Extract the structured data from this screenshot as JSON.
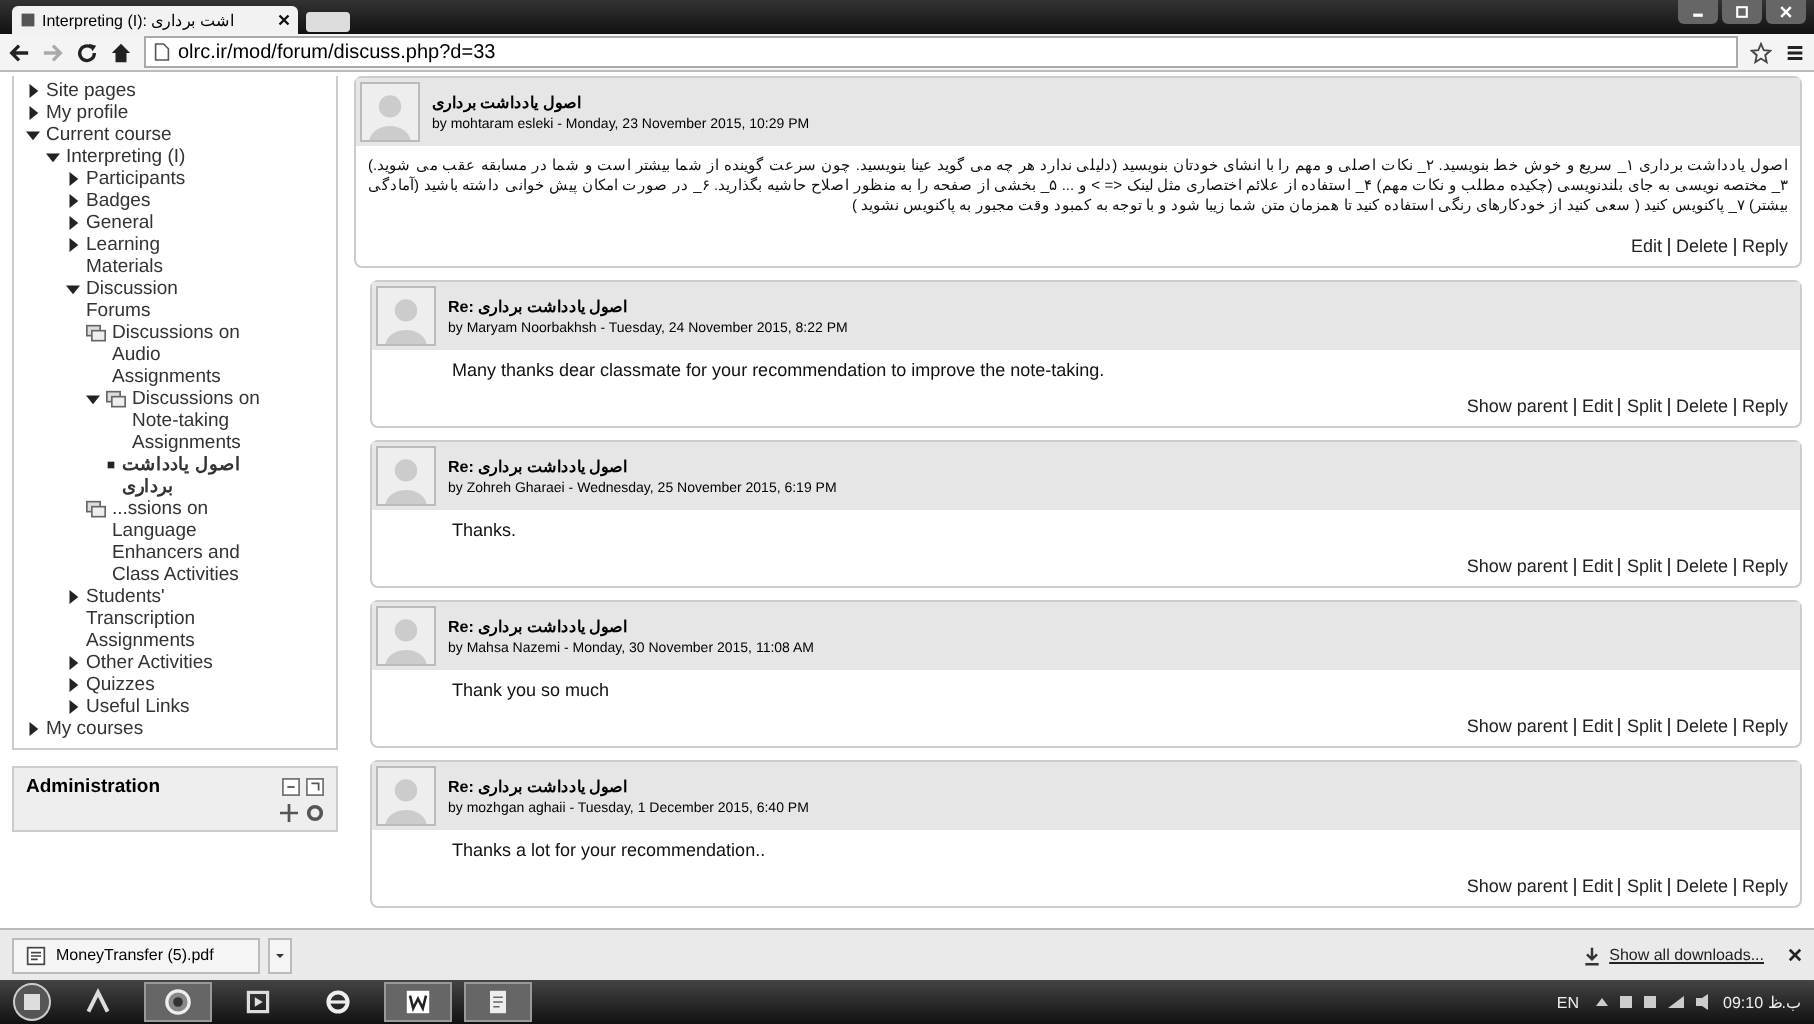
{
  "browser": {
    "tab_title": "Interpreting (I): اشت برداری",
    "url": "olrc.ir/mod/forum/discuss.php?d=33"
  },
  "sidebar": {
    "items": [
      {
        "kind": "branch",
        "label": "Site pages",
        "expanded": false
      },
      {
        "kind": "branch",
        "label": "My profile",
        "expanded": false
      },
      {
        "kind": "branch",
        "label": "Current course",
        "expanded": true,
        "children": [
          {
            "kind": "branch",
            "label": "Interpreting (I)",
            "expanded": true,
            "children": [
              {
                "kind": "branch",
                "label": "Participants",
                "expanded": false
              },
              {
                "kind": "branch",
                "label": "Badges",
                "expanded": false
              },
              {
                "kind": "branch",
                "label": "General",
                "expanded": false
              },
              {
                "kind": "branch",
                "label": "Learning Materials",
                "expanded": false
              },
              {
                "kind": "branch",
                "label": "Discussion Forums",
                "expanded": true,
                "children": [
                  {
                    "kind": "forum",
                    "label": "Discussions on Audio Assignments"
                  },
                  {
                    "kind": "forum",
                    "label": "Discussions on Note-taking Assignments",
                    "expanded": true,
                    "children": [
                      {
                        "kind": "leaf",
                        "label": "اصول یادداشت برداری"
                      }
                    ]
                  },
                  {
                    "kind": "forum",
                    "label": "...ssions on Language Enhancers and Class Activities"
                  }
                ]
              },
              {
                "kind": "branch",
                "label": "Students' Transcription Assignments",
                "expanded": false
              },
              {
                "kind": "branch",
                "label": "Other Activities",
                "expanded": false
              },
              {
                "kind": "branch",
                "label": "Quizzes",
                "expanded": false
              },
              {
                "kind": "branch",
                "label": "Useful Links",
                "expanded": false
              }
            ]
          }
        ]
      },
      {
        "kind": "branch",
        "label": "My courses",
        "expanded": false
      }
    ]
  },
  "administration": {
    "title": "Administration"
  },
  "post": {
    "subject": "اصول یادداشت برداری",
    "byline": "by mohtaram esleki - Monday, 23 November 2015, 10:29 PM",
    "body": "اصول یادداشت برداری ۱_ سریع و خوش خط بنویسید. ۲_ نکات اصلی و مهم را با انشای خودتان بنویسید (دلیلی ندارد هر چه می گوید عینا بنویسید. چون سرعت گوینده از شما بیشتر است و شما در مسابقه عقب می شوید.) ۳_ مختصه نویسی به جای بلندنویسی (چکیده مطلب و نکات مهم) ۴_ استفاده از علائم اختصاری مثل لینک <= > و ... ۵_ بخشی از صفحه را به منظور اصلاح حاشیه بگذارید. ۶_ در صورت امکان پیش خوانی داشته باشید (آمادگی بیشتر) ۷_ پاکنویس کنید ( سعی کنید از خودکارهای رنگی استفاده کنید تا همزمان متن شما زیبا شود و با توجه به کمبود وقت مجبور به پاکنویس نشوید )",
    "actions": [
      "Edit",
      "Delete",
      "Reply"
    ]
  },
  "replies": [
    {
      "subject": "Re: اصول یادداشت برداری",
      "byline": "by Maryam Noorbakhsh - Tuesday, 24 November 2015, 8:22 PM",
      "body": "Many thanks dear classmate for your recommendation to improve the note-taking.",
      "actions": [
        "Show parent",
        "Edit",
        "Split",
        "Delete",
        "Reply"
      ]
    },
    {
      "subject": "Re: اصول یادداشت برداری",
      "byline": "by Zohreh Gharaei - Wednesday, 25 November 2015, 6:19 PM",
      "body": "Thanks.",
      "actions": [
        "Show parent",
        "Edit",
        "Split",
        "Delete",
        "Reply"
      ]
    },
    {
      "subject": "Re: اصول یادداشت برداری",
      "byline": "by Mahsa Nazemi - Monday, 30 November 2015, 11:08 AM",
      "body": "Thank you so much",
      "actions": [
        "Show parent",
        "Edit",
        "Split",
        "Delete",
        "Reply"
      ]
    },
    {
      "subject": "Re: اصول یادداشت برداری",
      "byline": "by mozhgan aghaii - Tuesday, 1 December 2015, 6:40 PM",
      "body": "Thanks a lot for your recommendation..",
      "actions": [
        "Show parent",
        "Edit",
        "Split",
        "Delete",
        "Reply"
      ]
    }
  ],
  "downloads": {
    "file": "MoneyTransfer (5).pdf",
    "show_all": "Show all downloads..."
  },
  "taskbar": {
    "language": "EN",
    "clock": "09:10 ب.ظ"
  }
}
